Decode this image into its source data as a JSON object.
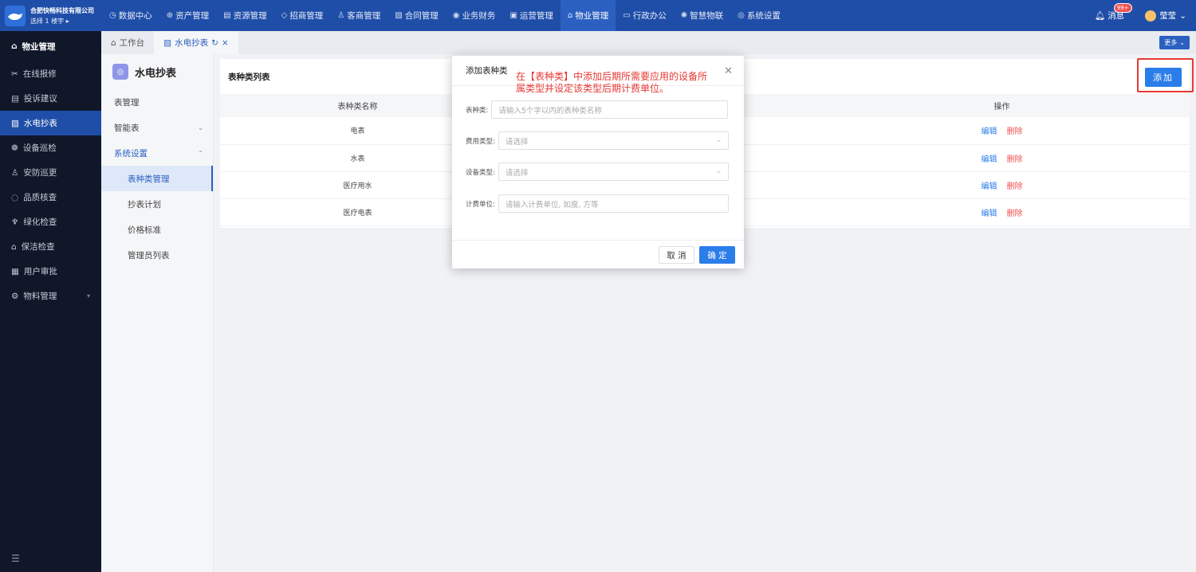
{
  "topbar": {
    "company": "合肥快畅科技有限公司",
    "building": "选择 1 楼宇 ▸",
    "nav": [
      {
        "label": "数据中心",
        "icon": "◷"
      },
      {
        "label": "资产管理",
        "icon": "⊕"
      },
      {
        "label": "资源管理",
        "icon": "▤"
      },
      {
        "label": "招商管理",
        "icon": "◇"
      },
      {
        "label": "客商管理",
        "icon": "♙"
      },
      {
        "label": "合同管理",
        "icon": "▧"
      },
      {
        "label": "业务财务",
        "icon": "◉"
      },
      {
        "label": "运营管理",
        "icon": "▣"
      },
      {
        "label": "物业管理",
        "icon": "⌂"
      },
      {
        "label": "行政办公",
        "icon": "▭"
      },
      {
        "label": "智慧物联",
        "icon": "✺"
      },
      {
        "label": "系统设置",
        "icon": "◎"
      }
    ],
    "message_label": "消息",
    "message_badge": "99+",
    "user_name": "莹莹"
  },
  "sidebar": {
    "header": "物业管理",
    "items": [
      {
        "label": "在线报修",
        "icon": "✂"
      },
      {
        "label": "投诉建议",
        "icon": "▤"
      },
      {
        "label": "水电抄表",
        "icon": "▨"
      },
      {
        "label": "设备巡检",
        "icon": "❁"
      },
      {
        "label": "安防巡更",
        "icon": "♙"
      },
      {
        "label": "品质核查",
        "icon": "◌"
      },
      {
        "label": "绿化检查",
        "icon": "♆"
      },
      {
        "label": "保洁检查",
        "icon": "⌂"
      },
      {
        "label": "用户审批",
        "icon": "▦"
      },
      {
        "label": "物料管理",
        "icon": "⚙"
      }
    ],
    "footer_icon": "☰"
  },
  "tabs": {
    "workbench": "工作台",
    "current": "水电抄表",
    "more": "更多"
  },
  "submenu": {
    "title": "水电抄表",
    "items": [
      {
        "label": "表管理"
      },
      {
        "label": "智能表"
      },
      {
        "label": "系统设置"
      },
      {
        "label": "表种类管理"
      },
      {
        "label": "抄表计划"
      },
      {
        "label": "价格标准"
      },
      {
        "label": "管理员列表"
      }
    ]
  },
  "main": {
    "list_title": "表种类列表",
    "add_label": "添加",
    "columns": [
      "表种类名称",
      "操作"
    ],
    "rows": [
      {
        "name": "电表"
      },
      {
        "name": "水表"
      },
      {
        "name": "医疗用水"
      },
      {
        "name": "医疗电表"
      }
    ],
    "edit_label": "编辑",
    "delete_label": "删除"
  },
  "dialog": {
    "title": "添加表种类",
    "note": "在【表种类】中添加后期所需要应用的设备所属类型并设定该类型后期计费单位。",
    "fields": {
      "kind_label": "表种类:",
      "kind_placeholder": "请输入5个字以内的表种类名称",
      "fee_label": "费用类型:",
      "fee_placeholder": "请选择",
      "device_label": "设备类型:",
      "device_placeholder": "请选择",
      "unit_label": "计费单位:",
      "unit_placeholder": "请输入计费单位, 如度, 方等"
    },
    "cancel": "取 消",
    "confirm": "确 定"
  },
  "colors": {
    "primary": "#2b7de9",
    "nav": "#1f4ea8",
    "sidebar": "#0f1729",
    "danger": "#f05050",
    "annotation": "#e53935"
  }
}
